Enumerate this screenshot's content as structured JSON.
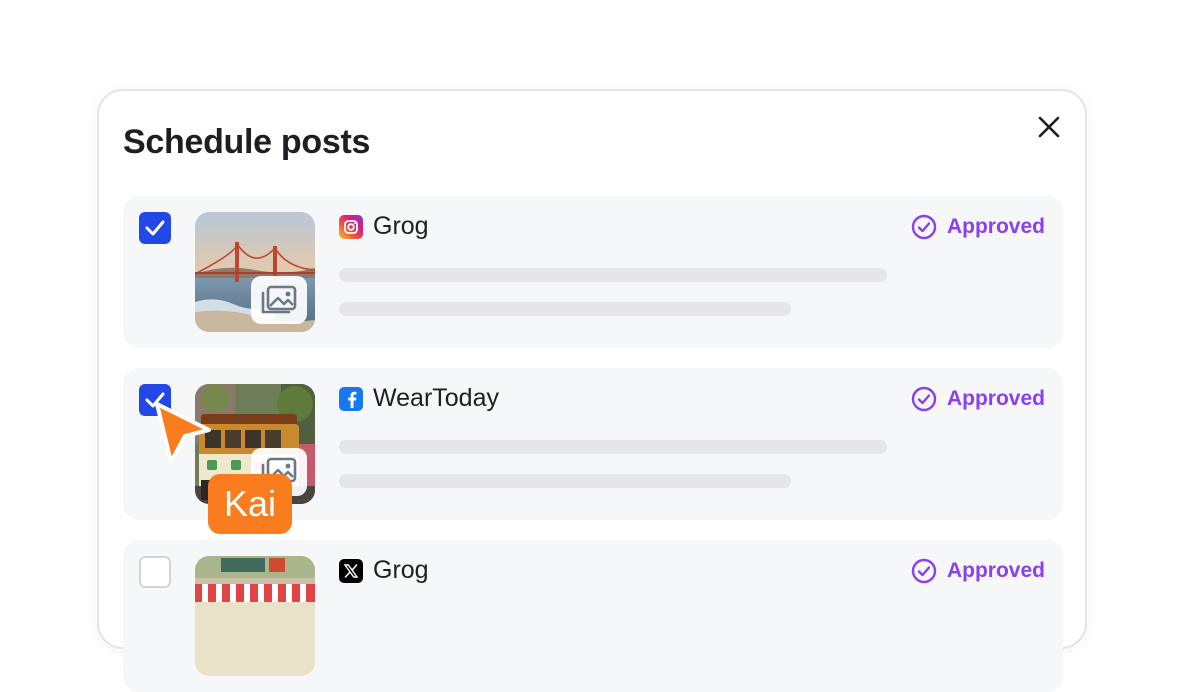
{
  "modal": {
    "title": "Schedule posts",
    "close_icon": "close-icon"
  },
  "posts": [
    {
      "checked": true,
      "platform": "instagram",
      "account": "Grog",
      "status": "Approved",
      "thumbnail": "golden-gate-bridge-photo",
      "media_icon": "image-gallery-icon"
    },
    {
      "checked": true,
      "platform": "facebook",
      "account": "WearToday",
      "status": "Approved",
      "thumbnail": "cable-car-photo",
      "media_icon": "image-gallery-icon"
    },
    {
      "checked": false,
      "platform": "x",
      "account": "Grog",
      "status": "Approved",
      "thumbnail": "storefront-photo"
    }
  ],
  "cursor": {
    "label": "Kai",
    "color": "#f97c1e"
  },
  "colors": {
    "checkbox": "#2348e6",
    "status": "#8b3ff0",
    "card": "#f6f7f9"
  }
}
